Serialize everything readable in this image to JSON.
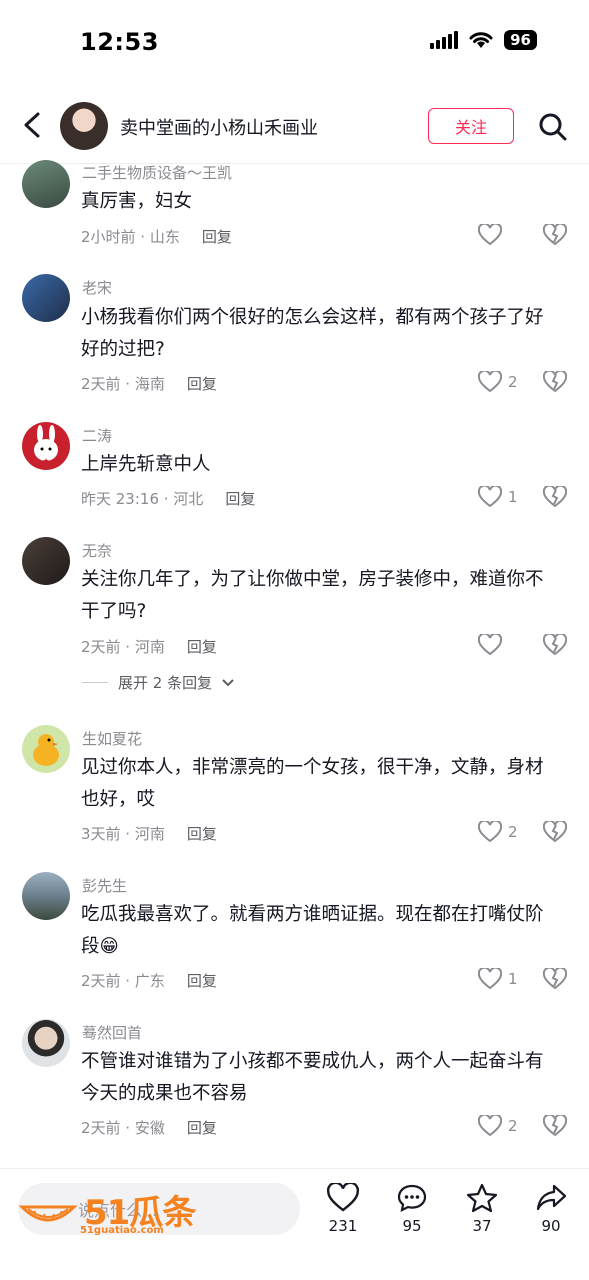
{
  "status": {
    "time": "12:53",
    "battery": "96"
  },
  "header": {
    "title": "卖中堂画的小杨山禾画业",
    "follow_label": "关注"
  },
  "comments": [
    {
      "name": "二手生物质设备～王凯",
      "text": "真厉害，妇女",
      "time": "2小时前 · 山东",
      "reply": "回复",
      "likes": ""
    },
    {
      "name": "老宋",
      "text": "小杨我看你们两个很好的怎么会这样，都有两个孩子了好好的过把?",
      "time": "2天前 · 海南",
      "reply": "回复",
      "likes": "2"
    },
    {
      "name": "二涛",
      "text": "上岸先斩意中人",
      "time": "昨天 23:16 · 河北",
      "reply": "回复",
      "likes": "1"
    },
    {
      "name": "无奈",
      "text": "关注你几年了，为了让你做中堂，房子装修中，难道你不干了吗?",
      "time": "2天前 · 河南",
      "reply": "回复",
      "likes": ""
    },
    {
      "name": "生如夏花",
      "text": "见过你本人，非常漂亮的一个女孩，很干净，文静，身材也好，哎",
      "time": "3天前 · 河南",
      "reply": "回复",
      "likes": "2"
    },
    {
      "name": "彭先生",
      "text": "吃瓜我最喜欢了。就看两方谁晒证据。现在都在打嘴仗阶段😁",
      "time": "2天前 · 广东",
      "reply": "回复",
      "likes": "1"
    },
    {
      "name": "蓦然回首",
      "text": "不管谁对谁错为了小孩都不要成仇人，两个人一起奋斗有今天的成果也不容易",
      "time": "2天前 · 安徽",
      "reply": "回复",
      "likes": "2"
    }
  ],
  "expand_label": "展开 2 条回复",
  "bottom": {
    "input_placeholder": "说点什么...",
    "watermark_big": "51瓜条",
    "watermark_small": "51guatiao.com",
    "like_count": "231",
    "comment_count": "95",
    "favorite_count": "37",
    "share_count": "90"
  },
  "colors": {
    "accent": "#fe2c55",
    "watermark": "#f58220",
    "text": "#161823",
    "muted": "#8a8b91"
  }
}
